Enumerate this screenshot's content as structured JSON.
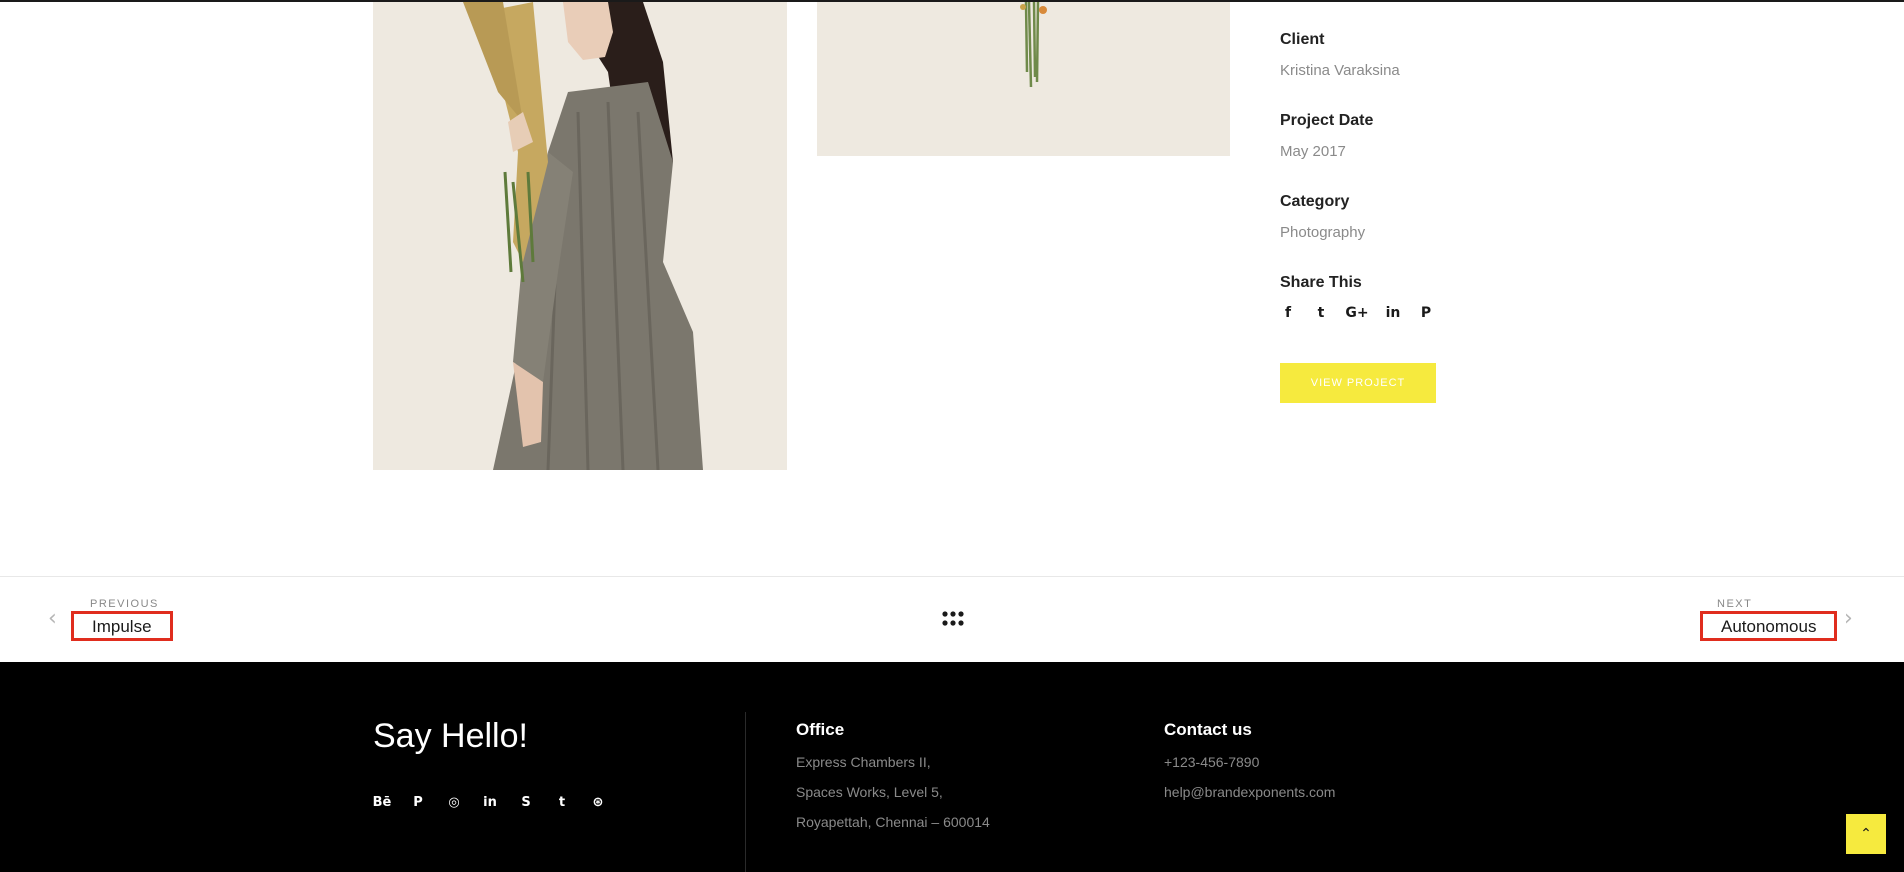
{
  "project": {
    "client_label": "Client",
    "client_value": "Kristina Varaksina",
    "date_label": "Project Date",
    "date_value": "May 2017",
    "category_label": "Category",
    "category_value": "Photography",
    "share_label": "Share This",
    "share_icons": [
      "facebook-icon",
      "twitter-icon",
      "google-plus-icon",
      "linkedin-icon",
      "pinterest-icon"
    ],
    "share_glyphs": {
      "facebook": "f",
      "twitter": "t",
      "googleplus": "G+",
      "linkedin": "in",
      "pinterest": "P"
    },
    "view_button": "View Project"
  },
  "nav": {
    "prev_small": "Previous",
    "prev_title": "Impulse",
    "next_small": "Next",
    "next_title": "Autonomous",
    "prev_arrow": "‹",
    "next_arrow": "›"
  },
  "footer": {
    "say_hello": "Say Hello!",
    "social_icons": [
      "behance-icon",
      "pinterest-icon",
      "instagram-icon",
      "linkedin-icon",
      "skype-icon",
      "twitter-icon",
      "dribbble-icon"
    ],
    "social_glyphs": {
      "behance": "Bē",
      "pinterest": "P",
      "instagram": "◎",
      "linkedin": "in",
      "skype": "S",
      "twitter": "t",
      "dribbble": "⊛"
    },
    "office_heading": "Office",
    "office_lines": [
      "Express Chambers II,",
      "Spaces Works, Level 5,",
      "Royapettah, Chennai – 600014"
    ],
    "contact_heading": "Contact us",
    "contact_lines": [
      "+123-456-7890",
      "help@brandexponents.com"
    ],
    "back_top": "⌃"
  },
  "colors": {
    "accent_yellow": "#f6ea3e",
    "highlight_red": "#e02d1e",
    "image_bg": "#eee9e0",
    "footer_bg": "#000000"
  }
}
